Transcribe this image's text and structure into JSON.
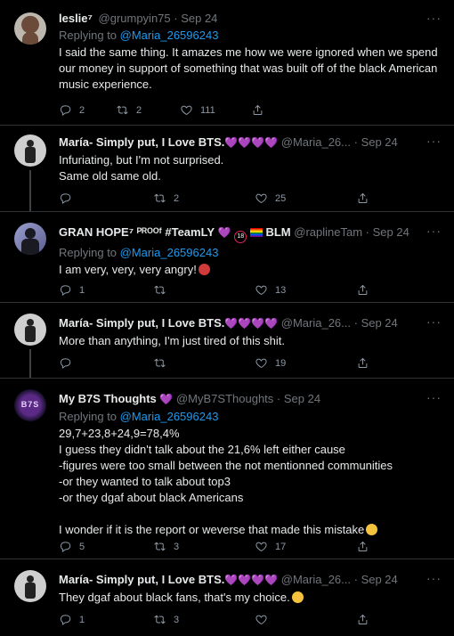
{
  "tweets": [
    {
      "name": "leslie⁷",
      "handle": "@grumpyin75",
      "date": "Sep 24",
      "replying_prefix": "Replying to ",
      "replying_to": "@Maria_26596243",
      "text": "I said the same thing. It amazes me how we were ignored when we spend our money in support of something that was built off of the black American music experience.",
      "replies": "2",
      "retweets": "2",
      "likes": "111"
    },
    {
      "name": "María- Simply put, I Love BTS.",
      "hearts": "💜💜💜💜",
      "handle": "@Maria_26...",
      "date": "Sep 24",
      "text": "Infuriating, but I'm not surprised.\nSame old same old.",
      "replies": "",
      "retweets": "2",
      "likes": "25"
    },
    {
      "name": "GRAN HOPE⁷ ᴾᴿᴼᴼᶠ #TeamLY",
      "name_tail": "BLM",
      "handle": "@raplineTam",
      "date": "Sep 24",
      "replying_prefix": "Replying to ",
      "replying_to": "@Maria_26596243",
      "text": "I am very, very, very angry!",
      "replies": "1",
      "retweets": "",
      "likes": "13"
    },
    {
      "name": "María- Simply put, I Love BTS.",
      "hearts": "💜💜💜💜",
      "handle": "@Maria_26...",
      "date": "Sep 24",
      "text": "More than anything, I'm just tired of this shit.",
      "replies": "",
      "retweets": "",
      "likes": "19"
    },
    {
      "name": "My B7S Thoughts",
      "hearts": "💜",
      "handle": "@MyB7SThoughts",
      "date": "Sep 24",
      "replying_prefix": "Replying to ",
      "replying_to": "@Maria_26596243",
      "text": "29,7+23,8+24,9=78,4%\nI guess they didn't talk about the 21,6% left either cause\n-figures were too small between the not mentionned communities\n-or they wanted to talk about top3\n-or they dgaf about black Americans\n\nI wonder if it is the report or weverse that made this mistake",
      "replies": "5",
      "retweets": "3",
      "likes": "17"
    },
    {
      "name": "María- Simply put, I Love BTS.",
      "hearts": "💜💜💜💜",
      "handle": "@Maria_26...",
      "date": "Sep 24",
      "text": "They dgaf about black fans, that's my choice.",
      "replies": "1",
      "retweets": "3",
      "likes": ""
    }
  ],
  "ui": {
    "dot": " · ",
    "more": "···",
    "avatar_b7s_label": "B7S"
  },
  "icons": {
    "reply": "reply-icon",
    "retweet": "retweet-icon",
    "like": "heart-icon",
    "share": "share-icon",
    "more": "more-icon"
  },
  "colors": {
    "background": "#000000",
    "text": "#e7e9ea",
    "secondary": "#71767b",
    "link": "#1d9bf0",
    "divider": "#2f3336",
    "purple_heart": "#a970ff"
  }
}
